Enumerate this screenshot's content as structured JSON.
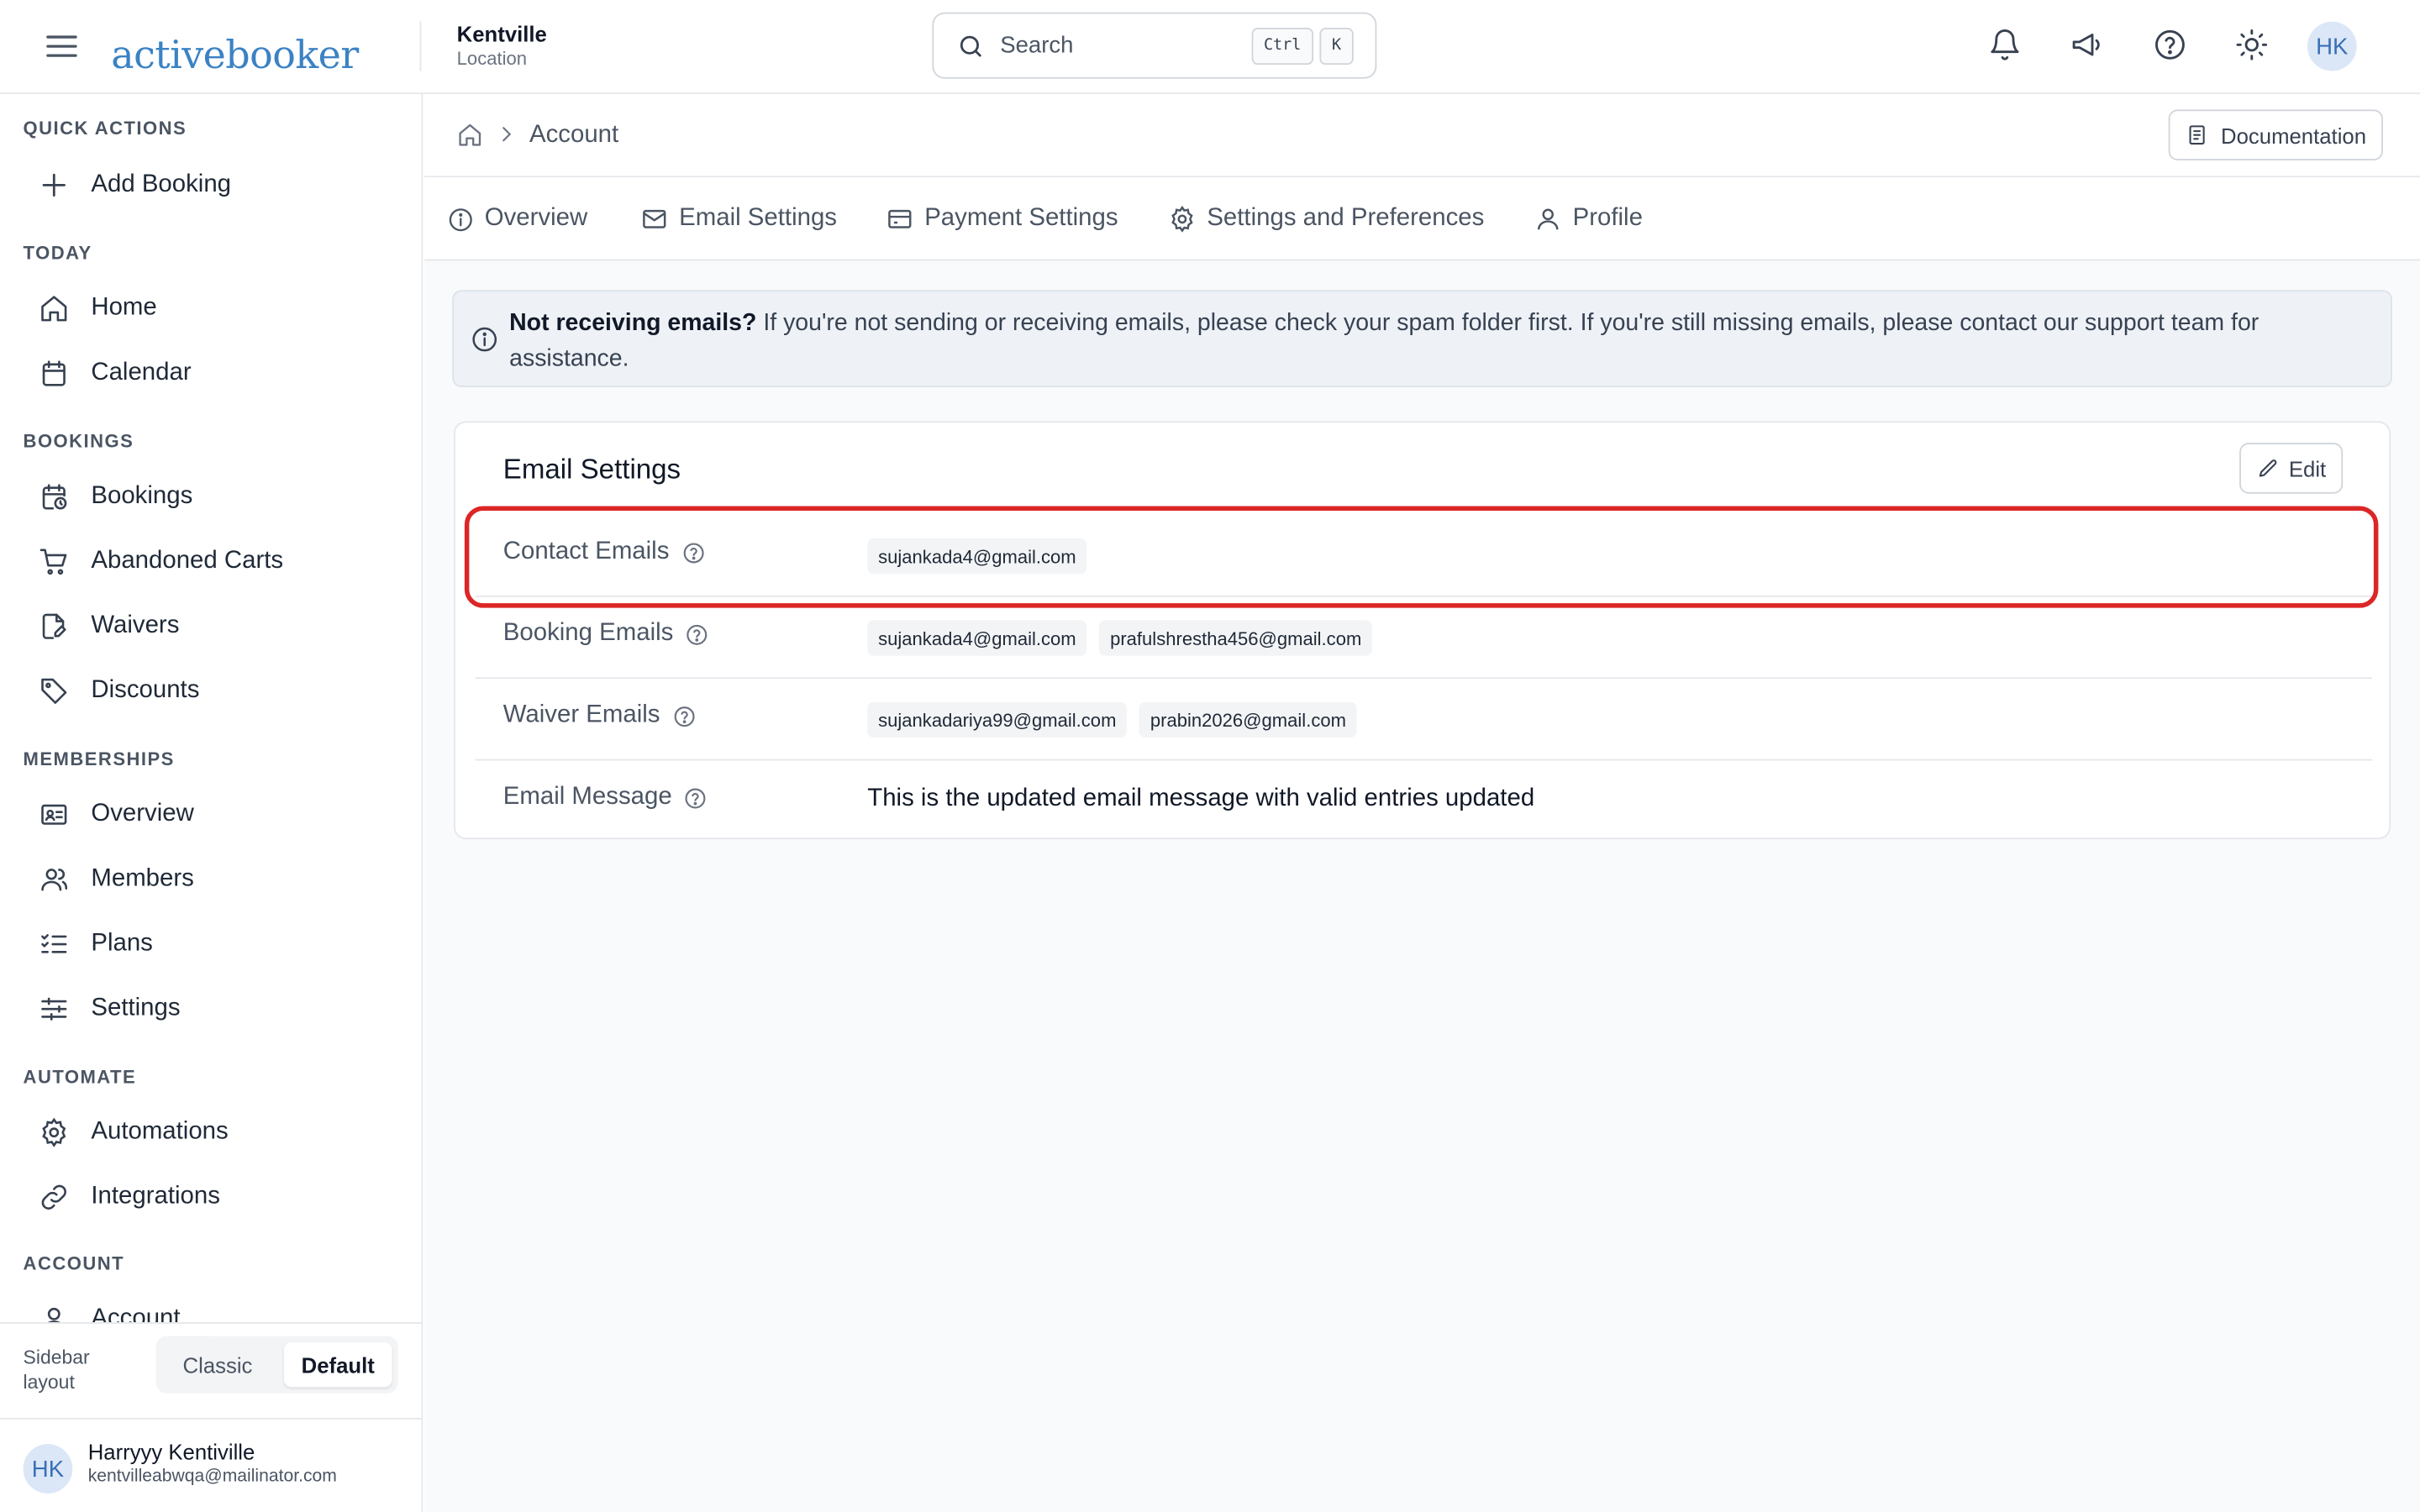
{
  "header": {
    "logo_text": "activebooker",
    "location_name": "Kentville",
    "location_sub": "Location",
    "search_placeholder": "Search",
    "kbd_ctrl": "Ctrl",
    "kbd_k": "K",
    "avatar_initials": "HK",
    "brand_color": "#3b82c4"
  },
  "sidebar": {
    "sections": [
      {
        "title": "QUICK ACTIONS",
        "items": [
          {
            "label": "Add Booking",
            "icon": "plus-icon"
          }
        ]
      },
      {
        "title": "TODAY",
        "items": [
          {
            "label": "Home",
            "icon": "home-icon"
          },
          {
            "label": "Calendar",
            "icon": "calendar-icon"
          }
        ]
      },
      {
        "title": "BOOKINGS",
        "items": [
          {
            "label": "Bookings",
            "icon": "calendar-clock-icon"
          },
          {
            "label": "Abandoned Carts",
            "icon": "cart-icon"
          },
          {
            "label": "Waivers",
            "icon": "file-signature-icon"
          },
          {
            "label": "Discounts",
            "icon": "tag-icon"
          }
        ]
      },
      {
        "title": "MEMBERSHIPS",
        "items": [
          {
            "label": "Overview",
            "icon": "id-card-icon"
          },
          {
            "label": "Members",
            "icon": "users-icon"
          },
          {
            "label": "Plans",
            "icon": "list-checks-icon"
          },
          {
            "label": "Settings",
            "icon": "sliders-icon"
          }
        ]
      },
      {
        "title": "AUTOMATE",
        "items": [
          {
            "label": "Automations",
            "icon": "cog-icon"
          },
          {
            "label": "Integrations",
            "icon": "link-icon"
          }
        ]
      },
      {
        "title": "ACCOUNT",
        "items": [
          {
            "label": "Account",
            "icon": "user-icon"
          }
        ]
      }
    ],
    "layout_label": "Sidebar layout",
    "layout_options": [
      "Classic",
      "Default"
    ],
    "layout_selected": "Default",
    "user": {
      "initials": "HK",
      "name": "Harryyy Kentiville",
      "email": "kentvilleabwqa@mailinator.com"
    }
  },
  "main": {
    "breadcrumb": "Account",
    "documentation_label": "Documentation",
    "tabs": [
      {
        "label": "Overview",
        "icon": "info-icon"
      },
      {
        "label": "Email Settings",
        "icon": "mail-icon"
      },
      {
        "label": "Payment Settings",
        "icon": "credit-card-icon"
      },
      {
        "label": "Settings and Preferences",
        "icon": "gear-icon"
      },
      {
        "label": "Profile",
        "icon": "user-icon"
      }
    ],
    "alert": {
      "bold": "Not receiving emails?",
      "text": " If you're not sending or receiving emails, please check your spam folder first. If you're still missing emails, please contact our support team for assistance."
    },
    "card": {
      "title": "Email Settings",
      "edit_label": "Edit",
      "rows": [
        {
          "label": "Contact Emails",
          "values": [
            "sujankada4@gmail.com"
          ]
        },
        {
          "label": "Booking Emails",
          "values": [
            "sujankada4@gmail.com",
            "prafulshrestha456@gmail.com"
          ]
        },
        {
          "label": "Waiver Emails",
          "values": [
            "sujankadariya99@gmail.com",
            "prabin2026@gmail.com"
          ]
        },
        {
          "label": "Email Message",
          "message": "This is the updated email message with valid entries updated"
        }
      ]
    },
    "highlight_color": "#dc2626"
  }
}
